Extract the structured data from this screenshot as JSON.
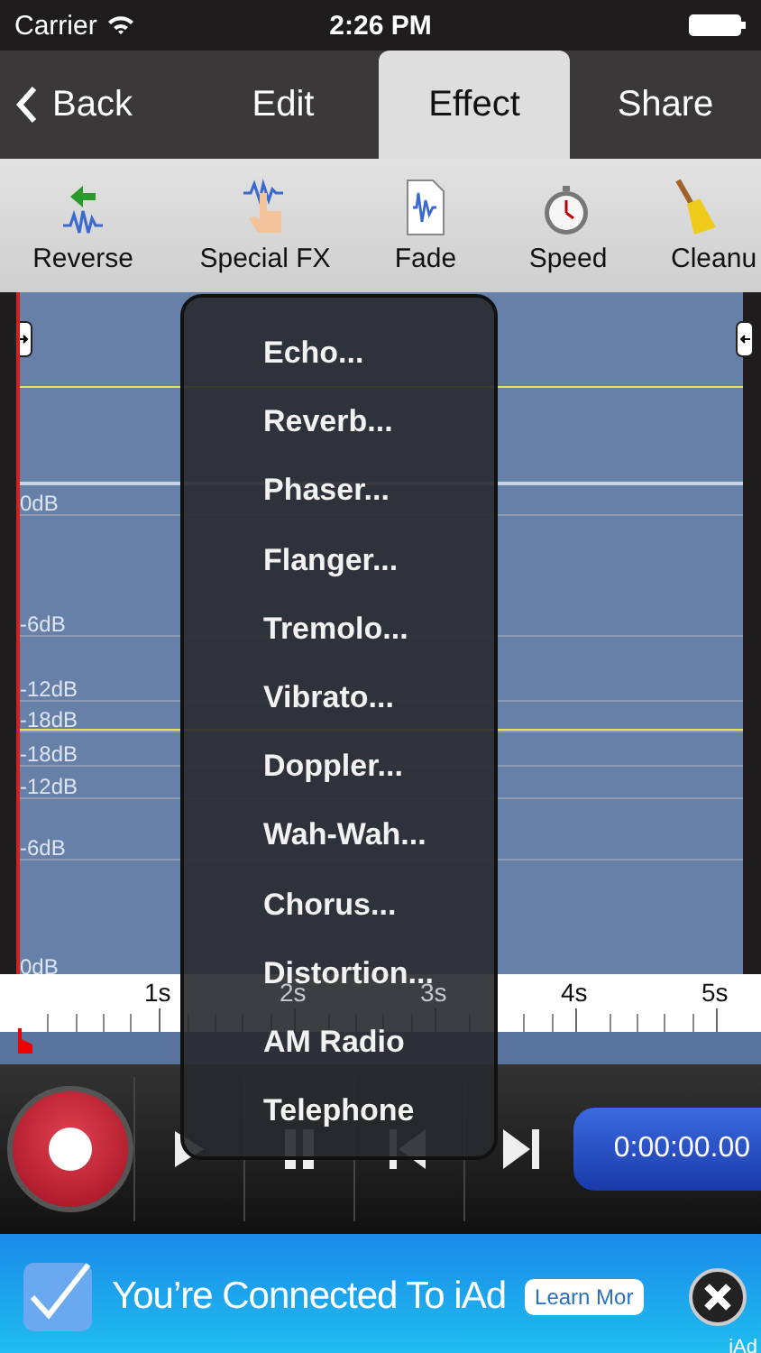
{
  "status_bar": {
    "carrier": "Carrier",
    "time": "2:26 PM"
  },
  "nav": {
    "back": "Back",
    "tabs": [
      {
        "label": "Edit",
        "selected": false
      },
      {
        "label": "Effect",
        "selected": true
      },
      {
        "label": "Share",
        "selected": false
      }
    ]
  },
  "toolbar": {
    "tools": [
      {
        "label": "Reverse"
      },
      {
        "label": "Special FX"
      },
      {
        "label": "Fade"
      },
      {
        "label": "Speed"
      },
      {
        "label": "Cleanu"
      }
    ]
  },
  "waveform": {
    "db_labels": [
      "0dB",
      "-6dB",
      "-12dB",
      "-18dB",
      "-18dB",
      "-12dB",
      "-6dB",
      "0dB"
    ],
    "ruler": [
      "1s",
      "2s",
      "3s",
      "4s",
      "5s"
    ]
  },
  "effects_menu": {
    "items": [
      "Echo...",
      "Reverb...",
      "Phaser...",
      "Flanger...",
      "Tremolo...",
      "Vibrato...",
      "Doppler...",
      "Wah-Wah...",
      "Chorus...",
      "Distortion...",
      "AM Radio",
      "Telephone"
    ]
  },
  "transport": {
    "time": "0:00:00.00"
  },
  "ad": {
    "text": "You’re Connected To iAd",
    "button": "Learn Mor",
    "badge": "iAd"
  }
}
